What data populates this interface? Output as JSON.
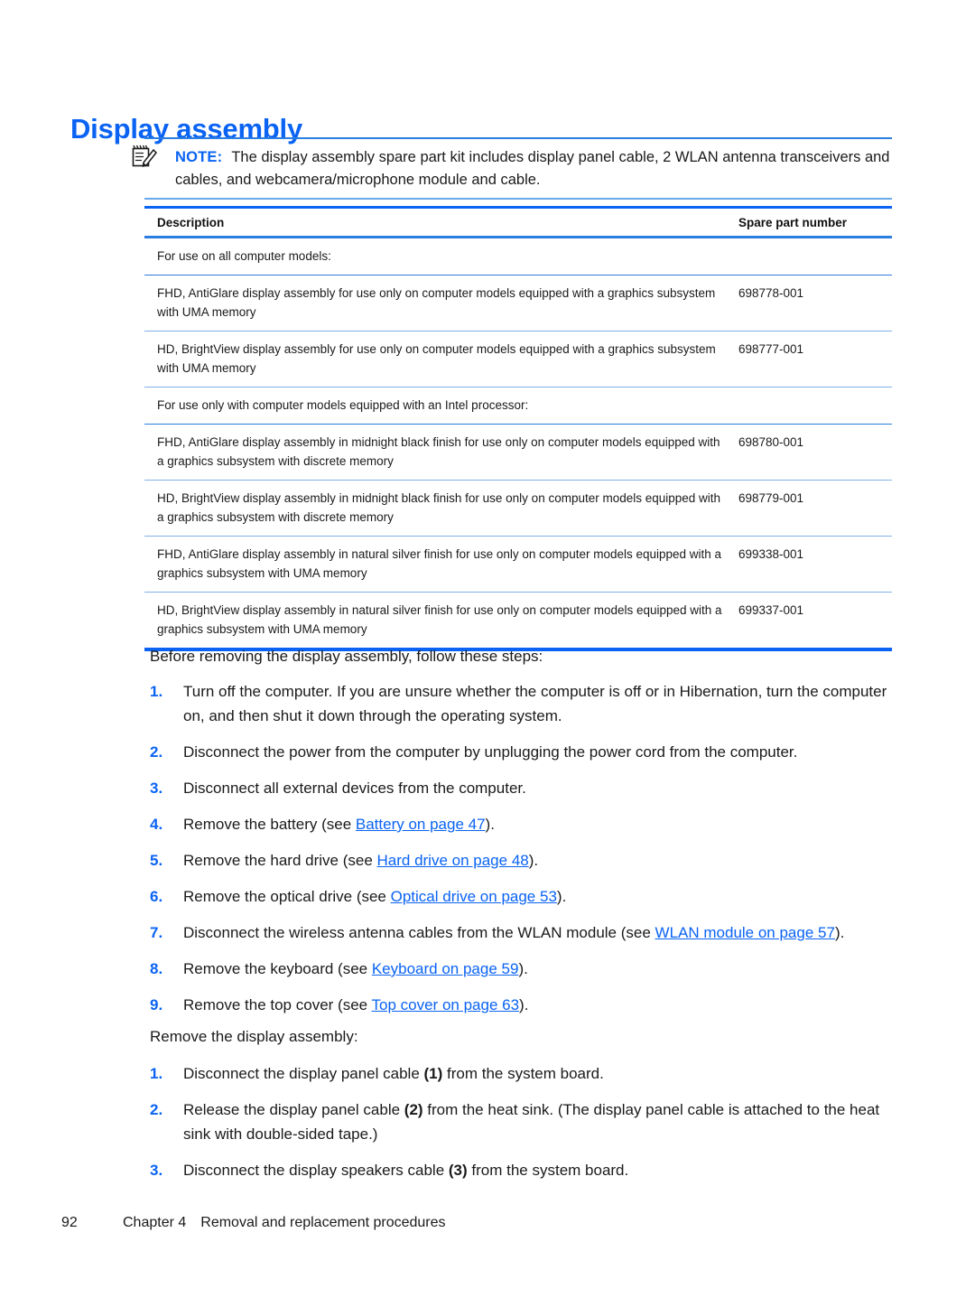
{
  "heading": "Display assembly",
  "note": {
    "icon": "note-pencil-icon",
    "label": "NOTE:",
    "text": "The display assembly spare part kit includes display panel cable, 2 WLAN antenna transceivers and cables, and webcamera/microphone module and cable."
  },
  "table": {
    "headers": {
      "description": "Description",
      "spare_part_number": "Spare part number"
    },
    "rows": [
      {
        "type": "group",
        "description": "For use on all computer models:",
        "spare_part_number": ""
      },
      {
        "type": "item",
        "description": "FHD, AntiGlare display assembly for use only on computer models equipped with a graphics subsystem with UMA memory",
        "spare_part_number": "698778-001"
      },
      {
        "type": "item",
        "description": "HD, BrightView display assembly for use only on computer models equipped with a graphics subsystem with UMA memory",
        "spare_part_number": "698777-001"
      },
      {
        "type": "group",
        "description": "For use only with computer models equipped with an Intel processor:",
        "spare_part_number": ""
      },
      {
        "type": "item",
        "description": "FHD, AntiGlare display assembly in midnight black finish for use only on computer models equipped with a graphics subsystem with discrete memory",
        "spare_part_number": "698780-001"
      },
      {
        "type": "item",
        "description": "HD, BrightView display assembly in midnight black finish for use only on computer models equipped with a graphics subsystem with discrete memory",
        "spare_part_number": "698779-001"
      },
      {
        "type": "item",
        "description": "FHD, AntiGlare display assembly in natural silver finish for use only on computer models equipped with a graphics subsystem with UMA memory",
        "spare_part_number": "699338-001"
      },
      {
        "type": "item",
        "description": "HD, BrightView display assembly in natural silver finish for use only on computer models equipped with a graphics subsystem with UMA memory",
        "spare_part_number": "699337-001"
      }
    ]
  },
  "before_intro": "Before removing the display assembly, follow these steps:",
  "before_steps": [
    {
      "num": "1.",
      "parts": [
        {
          "t": "text",
          "v": "Turn off the computer. If you are unsure whether the computer is off or in Hibernation, turn the computer on, and then shut it down through the operating system."
        }
      ]
    },
    {
      "num": "2.",
      "parts": [
        {
          "t": "text",
          "v": "Disconnect the power from the computer by unplugging the power cord from the computer."
        }
      ]
    },
    {
      "num": "3.",
      "parts": [
        {
          "t": "text",
          "v": "Disconnect all external devices from the computer."
        }
      ]
    },
    {
      "num": "4.",
      "parts": [
        {
          "t": "text",
          "v": "Remove the battery (see "
        },
        {
          "t": "link",
          "v": "Battery on page 47"
        },
        {
          "t": "text",
          "v": ")."
        }
      ]
    },
    {
      "num": "5.",
      "parts": [
        {
          "t": "text",
          "v": "Remove the hard drive (see "
        },
        {
          "t": "link",
          "v": "Hard drive on page 48"
        },
        {
          "t": "text",
          "v": ")."
        }
      ]
    },
    {
      "num": "6.",
      "parts": [
        {
          "t": "text",
          "v": "Remove the optical drive (see "
        },
        {
          "t": "link",
          "v": "Optical drive on page 53"
        },
        {
          "t": "text",
          "v": ")."
        }
      ]
    },
    {
      "num": "7.",
      "parts": [
        {
          "t": "text",
          "v": "Disconnect the wireless antenna cables from the WLAN module (see "
        },
        {
          "t": "link",
          "v": "WLAN module on page 57"
        },
        {
          "t": "text",
          "v": ")."
        }
      ]
    },
    {
      "num": "8.",
      "parts": [
        {
          "t": "text",
          "v": "Remove the keyboard (see "
        },
        {
          "t": "link",
          "v": "Keyboard on page 59"
        },
        {
          "t": "text",
          "v": ")."
        }
      ]
    },
    {
      "num": "9.",
      "parts": [
        {
          "t": "text",
          "v": "Remove the top cover (see "
        },
        {
          "t": "link",
          "v": "Top cover on page 63"
        },
        {
          "t": "text",
          "v": ")."
        }
      ]
    }
  ],
  "remove_intro": "Remove the display assembly:",
  "remove_steps": [
    {
      "num": "1.",
      "parts": [
        {
          "t": "text",
          "v": "Disconnect the display panel cable "
        },
        {
          "t": "bold",
          "v": "(1)"
        },
        {
          "t": "text",
          "v": " from the system board."
        }
      ]
    },
    {
      "num": "2.",
      "parts": [
        {
          "t": "text",
          "v": "Release the display panel cable "
        },
        {
          "t": "bold",
          "v": "(2)"
        },
        {
          "t": "text",
          "v": " from the heat sink. (The display panel cable is attached to the heat sink with double-sided tape.)"
        }
      ]
    },
    {
      "num": "3.",
      "parts": [
        {
          "t": "text",
          "v": "Disconnect the display speakers cable "
        },
        {
          "t": "bold",
          "v": "(3)"
        },
        {
          "t": "text",
          "v": " from the system board."
        }
      ]
    }
  ],
  "footer": {
    "page_number": "92",
    "chapter": "Chapter 4",
    "chapter_title": "Removal and replacement procedures"
  },
  "colors": {
    "accent_blue": "#0a63f3",
    "rule_blue": "#2a7de1",
    "light_rule_blue": "#7fb2e8",
    "text": "#1a1a1a"
  }
}
